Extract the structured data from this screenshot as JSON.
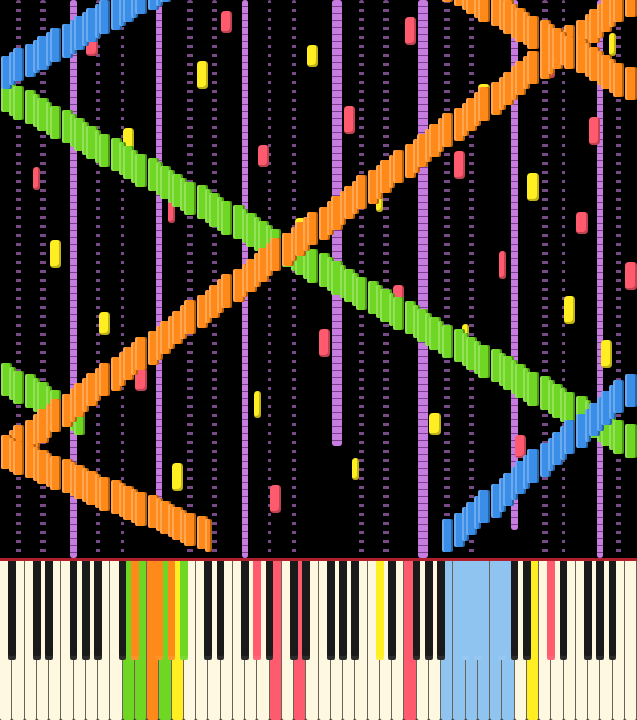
{
  "visualizer": {
    "kind": "midi-piano-roll",
    "keys": 88,
    "first_key": "A0",
    "roll_span": 100
  },
  "runs": [
    {
      "fromKey": 0,
      "toKey": 87,
      "fromTime": 80,
      "toTime": 18,
      "length": 6,
      "color": "#6fd624"
    },
    {
      "fromKey": 0,
      "toKey": 10,
      "fromTime": 29,
      "toTime": 22,
      "length": 6,
      "color": "#6fd624"
    },
    {
      "fromKey": 60,
      "toKey": 70,
      "fromTime": 101,
      "toTime": 96,
      "length": 5,
      "color": "#6fd624"
    },
    {
      "fromKey": 0,
      "toKey": 87,
      "fromTime": 16,
      "toTime": 97,
      "length": 6,
      "color": "#ff8a1a"
    },
    {
      "fromKey": 60,
      "toKey": 87,
      "fromTime": 101,
      "toTime": 82,
      "length": 6,
      "color": "#ff8a1a"
    },
    {
      "fromKey": 0,
      "toKey": 28,
      "fromTime": 16,
      "toTime": 1,
      "length": 6,
      "color": "#ff8a1a"
    },
    {
      "fromKey": 0,
      "toKey": 24,
      "fromTime": 84,
      "toTime": 101,
      "length": 6,
      "color": "#3a8ee8"
    },
    {
      "fromKey": 62,
      "toKey": 87,
      "fromTime": 1,
      "toTime": 27,
      "length": 6,
      "color": "#3a8ee8"
    }
  ],
  "streams": [
    {
      "key": 9,
      "fromTime": 0,
      "toTime": 100,
      "kind": "thick",
      "color": "#c77ddf"
    },
    {
      "key": 21,
      "fromTime": 10,
      "toTime": 100,
      "kind": "thick",
      "color": "#c77ddf"
    },
    {
      "key": 33,
      "fromTime": 0,
      "toTime": 100,
      "kind": "thick",
      "color": "#c77ddf"
    },
    {
      "key": 46,
      "fromTime": 20,
      "toTime": 100,
      "kind": "thick",
      "color": "#c77ddf"
    },
    {
      "key": 58,
      "fromTime": 0,
      "toTime": 100,
      "kind": "thick",
      "color": "#c77ddf"
    },
    {
      "key": 71,
      "fromTime": 5,
      "toTime": 100,
      "kind": "thick",
      "color": "#c77ddf"
    },
    {
      "key": 83,
      "fromTime": 0,
      "toTime": 100,
      "kind": "thick",
      "color": "#c77ddf"
    },
    {
      "key": 2,
      "fromTime": 0,
      "toTime": 100,
      "kind": "thin",
      "color": "#c77ddf"
    },
    {
      "key": 5,
      "fromTime": 0,
      "toTime": 100,
      "kind": "thin",
      "color": "#c77ddf"
    },
    {
      "key": 13,
      "fromTime": 0,
      "toTime": 100,
      "kind": "thin",
      "color": "#c77ddf"
    },
    {
      "key": 16,
      "fromTime": 0,
      "toTime": 100,
      "kind": "thin",
      "color": "#c77ddf"
    },
    {
      "key": 26,
      "fromTime": 0,
      "toTime": 100,
      "kind": "thin",
      "color": "#c77ddf"
    },
    {
      "key": 29,
      "fromTime": 0,
      "toTime": 100,
      "kind": "thin",
      "color": "#c77ddf"
    },
    {
      "key": 37,
      "fromTime": 0,
      "toTime": 100,
      "kind": "thin",
      "color": "#c77ddf"
    },
    {
      "key": 40,
      "fromTime": 0,
      "toTime": 100,
      "kind": "thin",
      "color": "#c77ddf"
    },
    {
      "key": 50,
      "fromTime": 0,
      "toTime": 100,
      "kind": "thin",
      "color": "#c77ddf"
    },
    {
      "key": 53,
      "fromTime": 0,
      "toTime": 100,
      "kind": "thin",
      "color": "#c77ddf"
    },
    {
      "key": 62,
      "fromTime": 0,
      "toTime": 100,
      "kind": "thin",
      "color": "#c77ddf"
    },
    {
      "key": 65,
      "fromTime": 0,
      "toTime": 100,
      "kind": "thin",
      "color": "#c77ddf"
    },
    {
      "key": 75,
      "fromTime": 0,
      "toTime": 100,
      "kind": "thin",
      "color": "#c77ddf"
    },
    {
      "key": 78,
      "fromTime": 0,
      "toTime": 100,
      "kind": "thin",
      "color": "#c77ddf"
    },
    {
      "key": 86,
      "fromTime": 0,
      "toTime": 100,
      "kind": "thin",
      "color": "#c77ddf"
    }
  ],
  "notes": [
    {
      "key": 4,
      "time": 66,
      "length": 4,
      "color": "#ff5a6e"
    },
    {
      "key": 7,
      "time": 52,
      "length": 5,
      "color": "#ffee22"
    },
    {
      "key": 12,
      "time": 90,
      "length": 5,
      "color": "#ff5a6e"
    },
    {
      "key": 14,
      "time": 40,
      "length": 4,
      "color": "#ffee22"
    },
    {
      "key": 17,
      "time": 72,
      "length": 5,
      "color": "#ffee22"
    },
    {
      "key": 19,
      "time": 30,
      "length": 4,
      "color": "#ff5a6e"
    },
    {
      "key": 23,
      "time": 60,
      "length": 5,
      "color": "#ff5a6e"
    },
    {
      "key": 24,
      "time": 12,
      "length": 5,
      "color": "#ffee22"
    },
    {
      "key": 27,
      "time": 84,
      "length": 5,
      "color": "#ffee22"
    },
    {
      "key": 30,
      "time": 46,
      "length": 4,
      "color": "#ff5a6e"
    },
    {
      "key": 31,
      "time": 94,
      "length": 4,
      "color": "#ff5a6e"
    },
    {
      "key": 35,
      "time": 25,
      "length": 5,
      "color": "#ffee22"
    },
    {
      "key": 36,
      "time": 70,
      "length": 4,
      "color": "#ff5a6e"
    },
    {
      "key": 38,
      "time": 8,
      "length": 5,
      "color": "#ff5a6e"
    },
    {
      "key": 41,
      "time": 56,
      "length": 5,
      "color": "#ffee22"
    },
    {
      "key": 43,
      "time": 88,
      "length": 4,
      "color": "#ffee22"
    },
    {
      "key": 44,
      "time": 36,
      "length": 5,
      "color": "#ff5a6e"
    },
    {
      "key": 48,
      "time": 76,
      "length": 5,
      "color": "#ff5a6e"
    },
    {
      "key": 49,
      "time": 14,
      "length": 4,
      "color": "#ffee22"
    },
    {
      "key": 52,
      "time": 62,
      "length": 4,
      "color": "#ffee22"
    },
    {
      "key": 55,
      "time": 44,
      "length": 5,
      "color": "#ff5a6e"
    },
    {
      "key": 56,
      "time": 92,
      "length": 5,
      "color": "#ff5a6e"
    },
    {
      "key": 60,
      "time": 22,
      "length": 4,
      "color": "#ffee22"
    },
    {
      "key": 63,
      "time": 68,
      "length": 5,
      "color": "#ff5a6e"
    },
    {
      "key": 64,
      "time": 38,
      "length": 4,
      "color": "#ffee22"
    },
    {
      "key": 67,
      "time": 80,
      "length": 5,
      "color": "#ffee22"
    },
    {
      "key": 69,
      "time": 50,
      "length": 5,
      "color": "#ff5a6e"
    },
    {
      "key": 72,
      "time": 18,
      "length": 4,
      "color": "#ff5a6e"
    },
    {
      "key": 74,
      "time": 64,
      "length": 5,
      "color": "#ffee22"
    },
    {
      "key": 76,
      "time": 86,
      "length": 4,
      "color": "#ff5a6e"
    },
    {
      "key": 79,
      "time": 42,
      "length": 5,
      "color": "#ffee22"
    },
    {
      "key": 80,
      "time": 58,
      "length": 4,
      "color": "#ff5a6e"
    },
    {
      "key": 82,
      "time": 74,
      "length": 5,
      "color": "#ff5a6e"
    },
    {
      "key": 84,
      "time": 34,
      "length": 5,
      "color": "#ffee22"
    },
    {
      "key": 85,
      "time": 90,
      "length": 4,
      "color": "#ffee22"
    },
    {
      "key": 87,
      "time": 48,
      "length": 5,
      "color": "#ff5a6e"
    }
  ],
  "keyboard": {
    "pressed": [
      {
        "key": 17,
        "color": "#6fd624"
      },
      {
        "key": 18,
        "color": "#ff8a1a"
      },
      {
        "key": 19,
        "color": "#6fd624"
      },
      {
        "key": 20,
        "color": "#ff8a1a"
      },
      {
        "key": 21,
        "color": "#ff8a1a"
      },
      {
        "key": 22,
        "color": "#6fd624"
      },
      {
        "key": 23,
        "color": "#ff8a1a"
      },
      {
        "key": 24,
        "color": "#ffee22"
      },
      {
        "key": 25,
        "color": "#6fd624"
      },
      {
        "key": 35,
        "color": "#ff5a6e"
      },
      {
        "key": 38,
        "color": "#ff5a6e"
      },
      {
        "key": 41,
        "color": "#ff5a6e"
      },
      {
        "key": 52,
        "color": "#ffee22"
      },
      {
        "key": 56,
        "color": "#ff5a6e"
      },
      {
        "key": 62,
        "color": "#8fc4f0"
      },
      {
        "key": 63,
        "color": "#8fc4f0"
      },
      {
        "key": 64,
        "color": "#8fc4f0"
      },
      {
        "key": 65,
        "color": "#8fc4f0"
      },
      {
        "key": 66,
        "color": "#8fc4f0"
      },
      {
        "key": 67,
        "color": "#8fc4f0"
      },
      {
        "key": 68,
        "color": "#8fc4f0"
      },
      {
        "key": 69,
        "color": "#8fc4f0"
      },
      {
        "key": 70,
        "color": "#8fc4f0"
      },
      {
        "key": 74,
        "color": "#ffee22"
      },
      {
        "key": 76,
        "color": "#ff5a6e"
      }
    ]
  }
}
